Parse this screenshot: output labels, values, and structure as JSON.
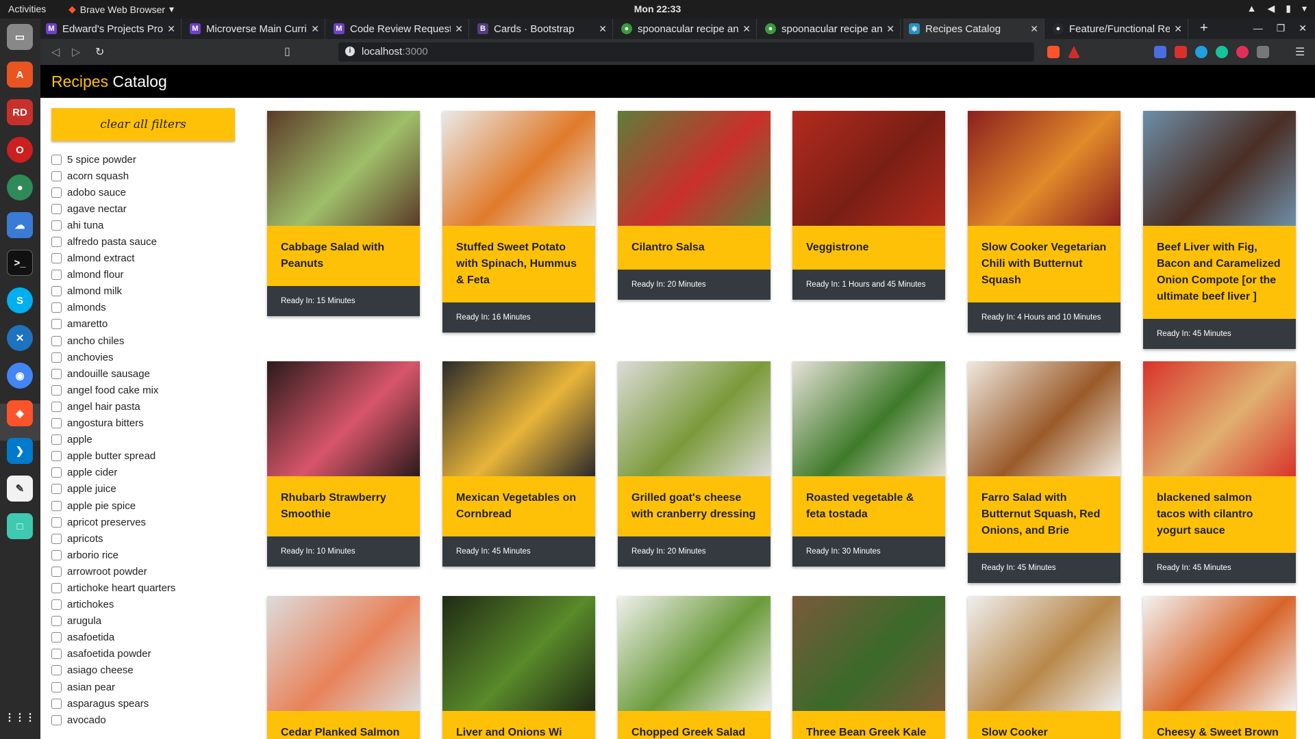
{
  "system": {
    "activities": "Activities",
    "app_name": "Brave Web Browser",
    "clock": "Mon 22:33"
  },
  "browser": {
    "tabs": [
      {
        "title": "Edward's Projects Pro",
        "favicon": "M",
        "color": "#6f42c1"
      },
      {
        "title": "Microverse Main Curric",
        "favicon": "M",
        "color": "#6f42c1"
      },
      {
        "title": "Code Review Request",
        "favicon": "M",
        "color": "#6f42c1"
      },
      {
        "title": "Cards · Bootstrap",
        "favicon": "B",
        "color": "#563d7c"
      },
      {
        "title": "spoonacular recipe an",
        "favicon": "●",
        "color": "#3a9a3a"
      },
      {
        "title": "spoonacular recipe an",
        "favicon": "●",
        "color": "#3a9a3a"
      },
      {
        "title": "Recipes Catalog",
        "favicon": "⚛",
        "color": "#2a8fbd"
      },
      {
        "title": "Feature/Functional Re",
        "favicon": "●",
        "color": "#2a2a2a"
      }
    ],
    "url_host": "localhost",
    "url_port": ":3000"
  },
  "app": {
    "brand_accent": "Recipes",
    "brand_rest": " Catalog",
    "clear_filters": "clear all filters",
    "accent_color": "#ffc107"
  },
  "filters": [
    "5 spice powder",
    "acorn squash",
    "adobo sauce",
    "agave nectar",
    "ahi tuna",
    "alfredo pasta sauce",
    "almond extract",
    "almond flour",
    "almond milk",
    "almonds",
    "amaretto",
    "ancho chiles",
    "anchovies",
    "andouille sausage",
    "angel food cake mix",
    "angel hair pasta",
    "angostura bitters",
    "apple",
    "apple butter spread",
    "apple cider",
    "apple juice",
    "apple pie spice",
    "apricot preserves",
    "apricots",
    "arborio rice",
    "arrowroot powder",
    "artichoke heart quarters",
    "artichokes",
    "arugula",
    "asafoetida",
    "asafoetida powder",
    "asiago cheese",
    "asian pear",
    "asparagus spears",
    "avocado"
  ],
  "recipes": [
    {
      "title": "Cabbage Salad with Peanuts",
      "ready": "Ready In: 15 Minutes",
      "img": [
        "#5b3a28",
        "#9fbf6a"
      ]
    },
    {
      "title": "Stuffed Sweet Potato with Spinach, Hummus & Feta",
      "ready": "Ready In: 16 Minutes",
      "img": [
        "#e9e9e9",
        "#e07a2a"
      ]
    },
    {
      "title": "Cilantro Salsa",
      "ready": "Ready In: 20 Minutes",
      "img": [
        "#5f7d3a",
        "#c9302c"
      ]
    },
    {
      "title": "Veggistrone",
      "ready": "Ready In: 1 Hours and 45 Minutes",
      "img": [
        "#b32a1e",
        "#7a1f15"
      ]
    },
    {
      "title": "Slow Cooker Vegetarian Chili with Butternut Squash",
      "ready": "Ready In: 4 Hours and 10 Minutes",
      "img": [
        "#8c1f1f",
        "#e08a2a"
      ]
    },
    {
      "title": "Beef Liver with Fig, Bacon and Caramelized Onion Compote [or the ultimate beef liver ]",
      "ready": "Ready In: 45 Minutes",
      "img": [
        "#6e8fa8",
        "#4a2e24"
      ]
    },
    {
      "title": "Rhubarb Strawberry Smoothie",
      "ready": "Ready In: 10 Minutes",
      "img": [
        "#2a1a1a",
        "#d8566a"
      ]
    },
    {
      "title": "Mexican Vegetables on Cornbread",
      "ready": "Ready In: 45 Minutes",
      "img": [
        "#2a2a2a",
        "#e8b43a"
      ]
    },
    {
      "title": "Grilled goat's cheese with cranberry dressing",
      "ready": "Ready In: 20 Minutes",
      "img": [
        "#dcdcd8",
        "#7a9a3a"
      ]
    },
    {
      "title": "Roasted vegetable & feta tostada",
      "ready": "Ready In: 30 Minutes",
      "img": [
        "#e6e1d8",
        "#3f7a2a"
      ]
    },
    {
      "title": "Farro Salad with Butternut Squash, Red Onions, and Brie",
      "ready": "Ready In: 45 Minutes",
      "img": [
        "#efe9df",
        "#9a5a2a"
      ]
    },
    {
      "title": "blackened salmon tacos with cilantro yogurt sauce",
      "ready": "Ready In: 45 Minutes",
      "img": [
        "#d8332a",
        "#e0b070"
      ]
    },
    {
      "title": "Cedar Planked Salmon",
      "ready": "",
      "img": [
        "#dcdcdc",
        "#e8825a"
      ]
    },
    {
      "title": "Liver and Onions Wi",
      "ready": "",
      "img": [
        "#1f2a14",
        "#5a8a2a"
      ]
    },
    {
      "title": "Chopped Greek Salad",
      "ready": "",
      "img": [
        "#f0f0ec",
        "#6a9a3a"
      ]
    },
    {
      "title": "Three Bean Greek Kale",
      "ready": "",
      "img": [
        "#7a5a3a",
        "#3a6a2a"
      ]
    },
    {
      "title": "Slow Cooker",
      "ready": "",
      "img": [
        "#efefef",
        "#b8884a"
      ]
    },
    {
      "title": "Cheesy & Sweet Brown",
      "ready": "",
      "img": [
        "#f2f2f2",
        "#d8652a"
      ]
    }
  ]
}
